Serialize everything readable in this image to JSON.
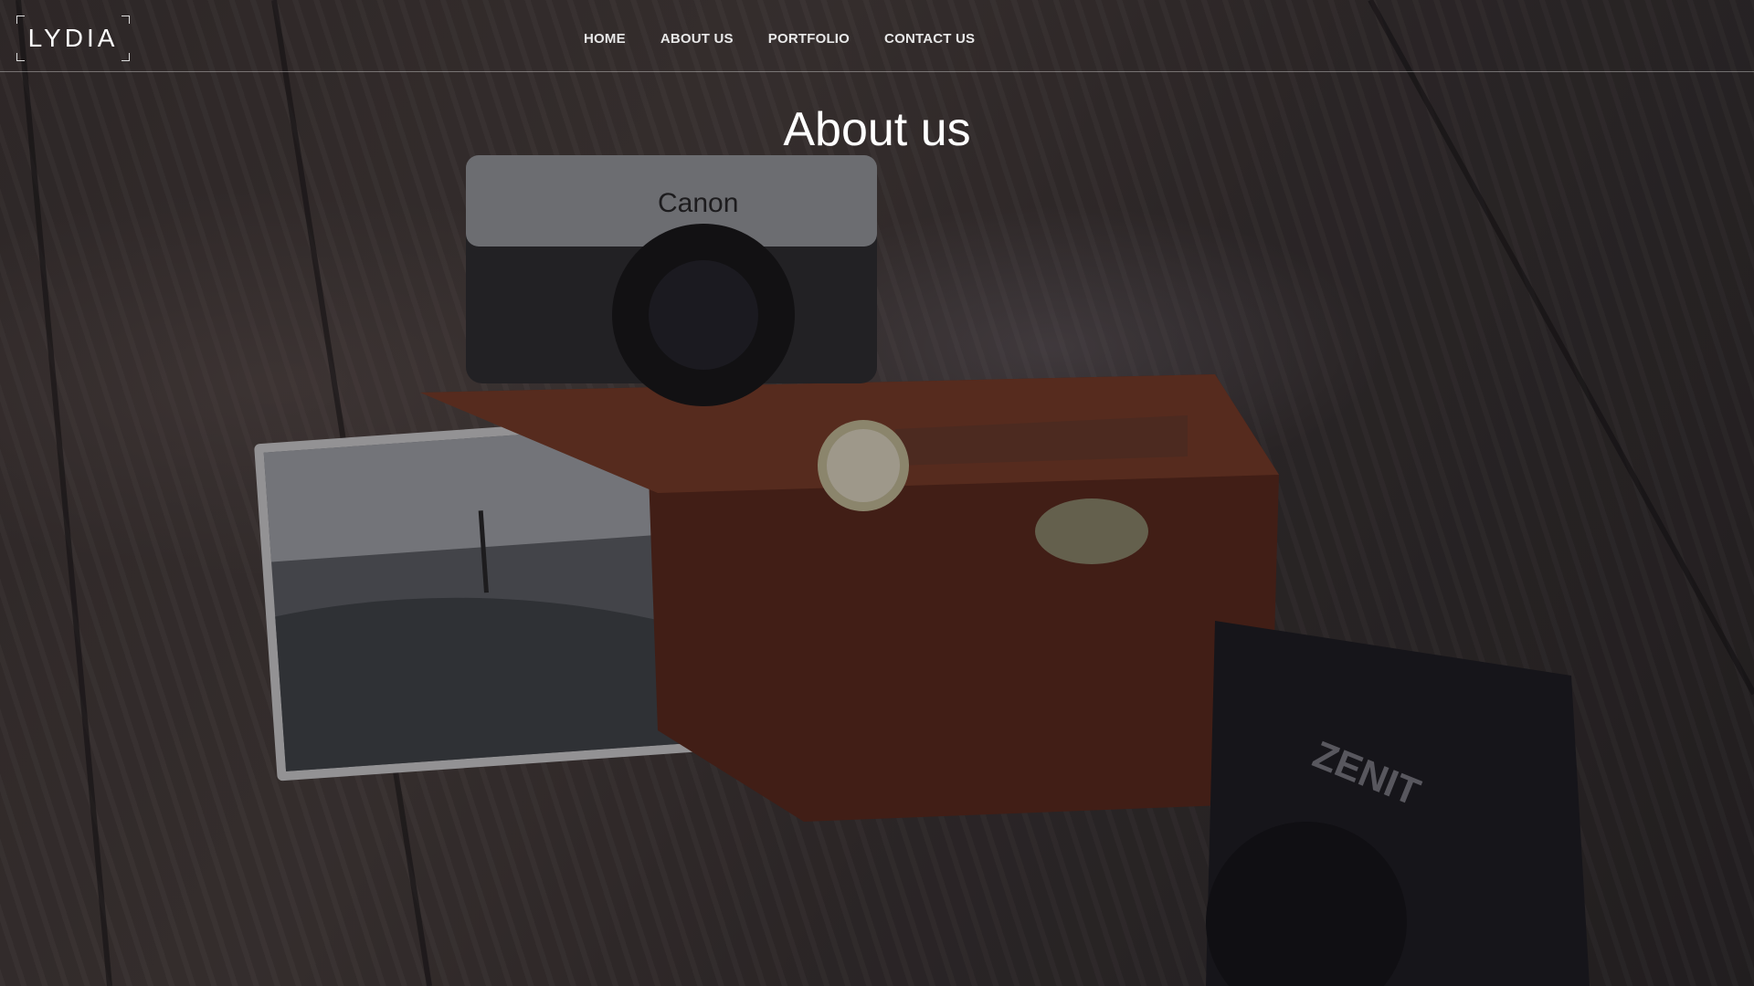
{
  "brand": {
    "logo_text": "LYDIA"
  },
  "nav": {
    "items": [
      {
        "label": "HOME"
      },
      {
        "label": "ABOUT US"
      },
      {
        "label": "PORTFOLIO"
      },
      {
        "label": "CONTACT US"
      }
    ]
  },
  "hero": {
    "title": "About us"
  },
  "scene": {
    "camera_top_brand": "Canon",
    "camera_bottom_brand": "ZENIT"
  },
  "colors": {
    "overlay": "#141216",
    "text": "#ffffff",
    "divider": "#8a8a8a"
  }
}
